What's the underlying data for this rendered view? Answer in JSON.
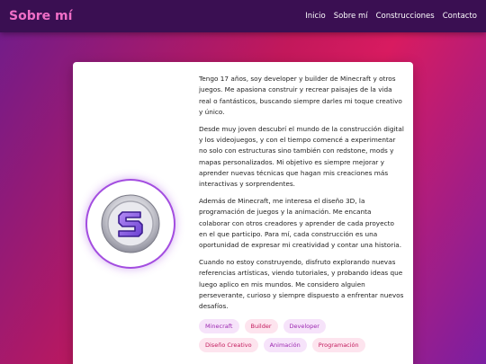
{
  "header": {
    "brand": "Sobre mí",
    "nav": [
      "Inicio",
      "Sobre mí",
      "Construcciones",
      "Contacto"
    ]
  },
  "profile": {
    "icon": "letter-s-logo-icon",
    "paragraphs": [
      "Tengo 17 años, soy developer y builder de Minecraft y otros juegos. Me apasiona construir y recrear paisajes de la vida real o fantásticos, buscando siempre darles mi toque creativo y único.",
      "Desde muy joven descubrí el mundo de la construcción digital y los videojuegos, y con el tiempo comencé a experimentar no solo con estructuras sino también con redstone, mods y mapas personalizados. Mi objetivo es siempre mejorar y aprender nuevas técnicas que hagan mis creaciones más interactivas y sorprendentes.",
      "Además de Minecraft, me interesa el diseño 3D, la programación de juegos y la animación. Me encanta colaborar con otros creadores y aprender de cada proyecto en el que participo. Para mí, cada construcción es una oportunidad de expresar mi creatividad y contar una historia.",
      "Cuando no estoy construyendo, disfruto explorando nuevas referencias artísticas, viendo tutoriales, y probando ideas que luego aplico en mis mundos. Me considero alguien perseverante, curioso y siempre dispuesto a enfrentar nuevos desafíos."
    ],
    "tags": [
      "Minecraft",
      "Builder",
      "Developer",
      "Diseño Creativo",
      "Animación",
      "Programación"
    ]
  },
  "colors": {
    "brand": "#f06ec7",
    "navbar": "#3a0f52",
    "accent": "#a34de0",
    "tag_text": "#9c27b0",
    "tag_bg": "#f6e3fa"
  }
}
